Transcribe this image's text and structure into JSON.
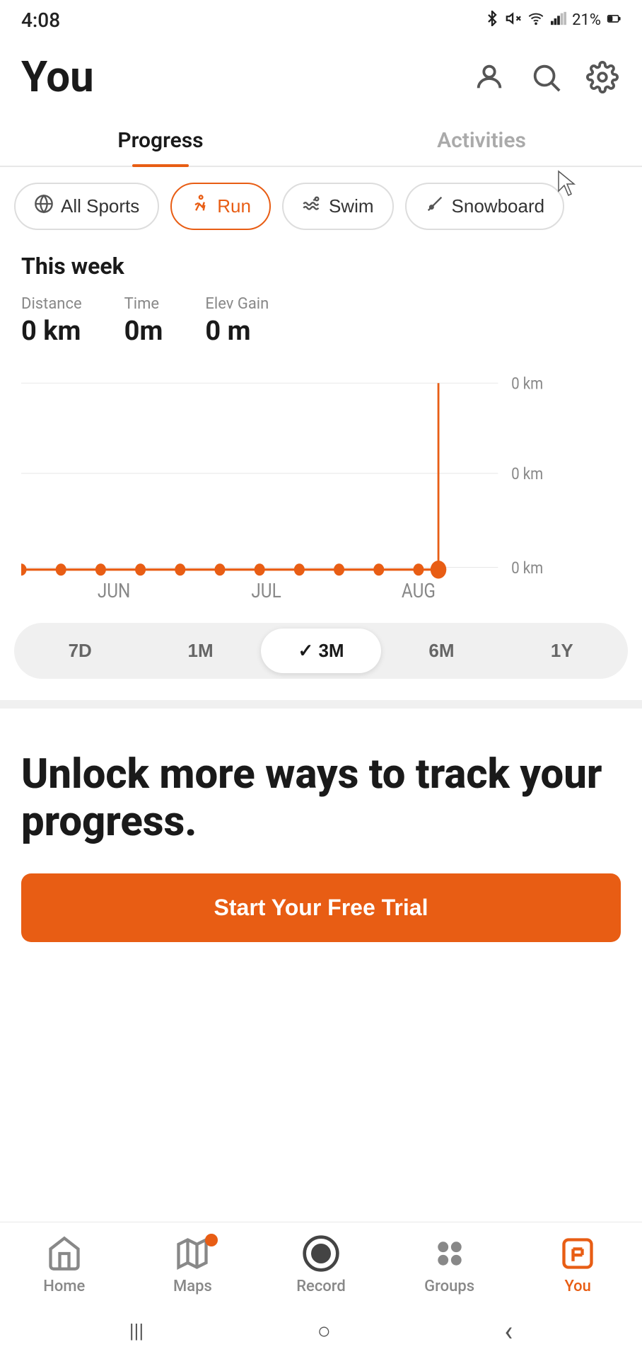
{
  "statusBar": {
    "time": "4:08",
    "battery": "21%"
  },
  "header": {
    "title": "You",
    "profileIcon": "person-icon",
    "searchIcon": "search-icon",
    "settingsIcon": "settings-icon"
  },
  "tabs": [
    {
      "label": "Progress",
      "active": true
    },
    {
      "label": "Activities",
      "active": false
    }
  ],
  "sportFilters": [
    {
      "label": "All Sports",
      "icon": "🏃",
      "active": false
    },
    {
      "label": "Run",
      "icon": "👟",
      "active": true
    },
    {
      "label": "Swim",
      "icon": "🌊",
      "active": false
    },
    {
      "label": "Snowboard",
      "icon": "✏️",
      "active": false
    }
  ],
  "thisWeek": {
    "title": "This week",
    "stats": [
      {
        "label": "Distance",
        "value": "0 km"
      },
      {
        "label": "Time",
        "value": "0m"
      },
      {
        "label": "Elev Gain",
        "value": "0 m"
      }
    ]
  },
  "chartLabels": {
    "yLabels": [
      "0 km",
      "0 km",
      "0 km"
    ],
    "xLabels": [
      "JUN",
      "JUL",
      "AUG"
    ]
  },
  "timeRanges": [
    {
      "label": "7D",
      "active": false
    },
    {
      "label": "1M",
      "active": false
    },
    {
      "label": "3M",
      "active": true,
      "checkmark": "✓"
    },
    {
      "label": "6M",
      "active": false
    },
    {
      "label": "1Y",
      "active": false
    }
  ],
  "upsell": {
    "title": "Unlock more ways to track your progress.",
    "buttonLabel": "Start Your Free Trial"
  },
  "bottomNav": [
    {
      "label": "Home",
      "icon": "home",
      "active": false
    },
    {
      "label": "Maps",
      "icon": "maps",
      "active": false,
      "badge": true
    },
    {
      "label": "Record",
      "icon": "record",
      "active": false
    },
    {
      "label": "Groups",
      "icon": "groups",
      "active": false
    },
    {
      "label": "You",
      "icon": "you",
      "active": true
    }
  ],
  "systemNav": {
    "menu": "|||",
    "home": "○",
    "back": "‹"
  }
}
